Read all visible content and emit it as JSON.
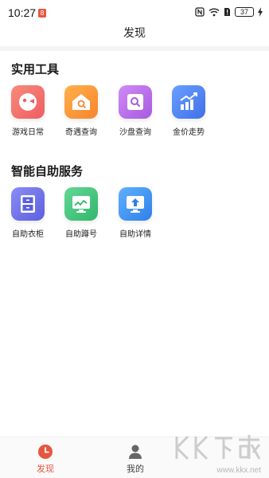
{
  "status_bar": {
    "time": "10:27",
    "notification_badge": "8",
    "battery_level": "37"
  },
  "app_bar": {
    "title": "发现"
  },
  "sections": {
    "tools": {
      "title": "实用工具",
      "items": [
        {
          "label": "游戏日常",
          "icon": "gamepad-icon",
          "color": "#f06a6a"
        },
        {
          "label": "奇遇查询",
          "icon": "home-search-icon",
          "color": "#f7943a"
        },
        {
          "label": "沙盘查询",
          "icon": "search-box-icon",
          "color": "#b56ae8"
        },
        {
          "label": "金价走势",
          "icon": "chart-trend-icon",
          "color": "#4e7ff0"
        }
      ]
    },
    "services": {
      "title": "智能自助服务",
      "items": [
        {
          "label": "自助衣柜",
          "icon": "cabinet-icon",
          "color": "#6b6ee8"
        },
        {
          "label": "自助蹲号",
          "icon": "monitor-chart-icon",
          "color": "#3fc07a"
        },
        {
          "label": "自助详情",
          "icon": "upload-screen-icon",
          "color": "#3a8ff0"
        }
      ]
    }
  },
  "tab_bar": {
    "tabs": [
      {
        "label": "发现",
        "icon": "clock-icon",
        "active": true
      },
      {
        "label": "我的",
        "icon": "user-icon",
        "active": false
      }
    ]
  },
  "watermark": {
    "logo": "KK下载",
    "url": "www.kkx.net"
  }
}
